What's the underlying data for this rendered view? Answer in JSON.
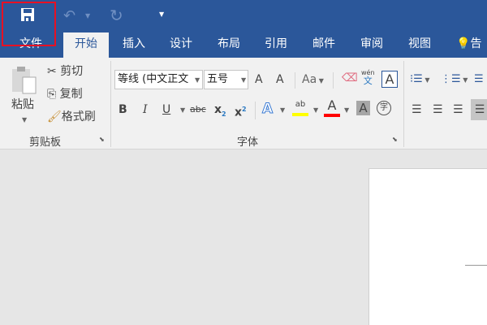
{
  "qat": {
    "save_icon": "save-icon",
    "undo_icon": "undo-icon",
    "redo_icon": "redo-icon",
    "customize_icon": "customize-qat-icon"
  },
  "tabs": [
    {
      "label": "文件"
    },
    {
      "label": "开始"
    },
    {
      "label": "插入"
    },
    {
      "label": "设计"
    },
    {
      "label": "布局"
    },
    {
      "label": "引用"
    },
    {
      "label": "邮件"
    },
    {
      "label": "审阅"
    },
    {
      "label": "视图"
    }
  ],
  "tell_me": {
    "label": "告诉",
    "icon": "lightbulb-icon"
  },
  "clipboard": {
    "paste": "粘贴",
    "cut": "剪切",
    "copy": "复制",
    "format_painter": "格式刷",
    "group": "剪贴板"
  },
  "font": {
    "name": "等线 (中文正文",
    "size": "五号",
    "group": "字体",
    "grow": "A",
    "shrink": "A",
    "case": "Aa",
    "phonetic_top": "wén",
    "phonetic_bottom": "文",
    "border_char": "A",
    "bold": "B",
    "italic": "I",
    "underline": "U",
    "strike": "abc",
    "sub": "x",
    "sub2": "2",
    "sup": "x",
    "sup2": "2",
    "effects": "A",
    "highlight": "ab",
    "color": "A",
    "shade": "A",
    "enclose": "字"
  },
  "colors": {
    "accent": "#2b579a",
    "highlight": "#ffff00",
    "font_color": "#ff0000",
    "selection": "#e81123"
  }
}
